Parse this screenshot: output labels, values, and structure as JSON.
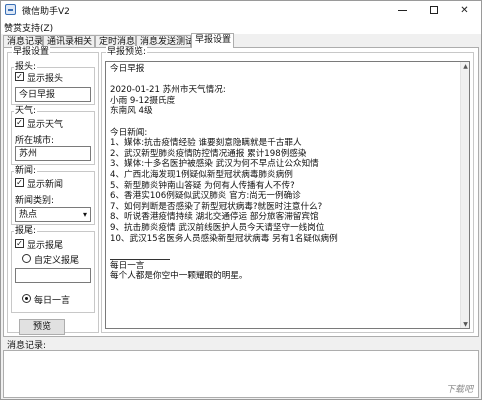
{
  "window": {
    "title": "微信助手V2",
    "min_label": "—",
    "max_label": "☐",
    "close_label": "✕"
  },
  "menu": {
    "items": [
      "赞赏支持(Z)"
    ]
  },
  "tabs": [
    "消息记录",
    "通讯录相关",
    "定时消息",
    "消息发送测试",
    "早报设置"
  ],
  "active_tab": "早报设置",
  "settings": {
    "group_title": "早报设置",
    "header": {
      "title": "报头:",
      "show_label": "显示报头",
      "show_checked": true,
      "value": "今日早报"
    },
    "weather": {
      "title": "天气:",
      "show_label": "显示天气",
      "show_checked": true,
      "city_label": "所在城市:",
      "city_value": "苏州"
    },
    "news": {
      "title": "新闻:",
      "show_label": "显示新闻",
      "show_checked": true,
      "category_label": "新闻类别:",
      "category_value": "热点"
    },
    "footer": {
      "title": "报尾:",
      "show_label": "显示报尾",
      "show_checked": true,
      "custom_label": "自定义报尾",
      "custom_selected": false,
      "custom_value": "",
      "daily_label": "每日一言",
      "daily_selected": true
    },
    "preview_button": "预览"
  },
  "preview": {
    "group_title": "早报预览:",
    "lines": [
      "今日早报",
      "",
      "2020-01-21  苏州市天气情况:",
      "小雨  9-12摄氏度",
      "东南风 4级",
      "",
      "今日新闻:",
      "1、媒体:抗击疫情经验 谁要刻意隐瞒就是千古罪人",
      "2、武汉新型肺炎疫情防控情况通报 累计198例感染",
      "3、媒体:十多名医护被感染 武汉为何不早点让公众知情",
      "4、广西北海发现1例疑似新型冠状病毒肺炎病例",
      "5、新型肺炎钟南山答疑 为何有人传播有人不传?",
      "6、香港实106例疑似武汉肺炎 官方:尚无一例确诊",
      "7、如何判断是否感染了新型冠状病毒?就医时注意什么?",
      "8、听说香港疫情持续 湖北交通停运 部分旅客滞留宾馆",
      "9、抗击肺炎疫情 武汉前线医护人员今天请坚守一线岗位",
      "10、武汉15名医务人员感染新型冠状病毒 另有1名疑似病例",
      ""
    ],
    "footer_title": "每日一言",
    "footer_text": "每个人都是你空中一颗耀眼的明星。"
  },
  "log": {
    "label": "消息记录:"
  },
  "watermark": {
    "text": "下载吧"
  }
}
